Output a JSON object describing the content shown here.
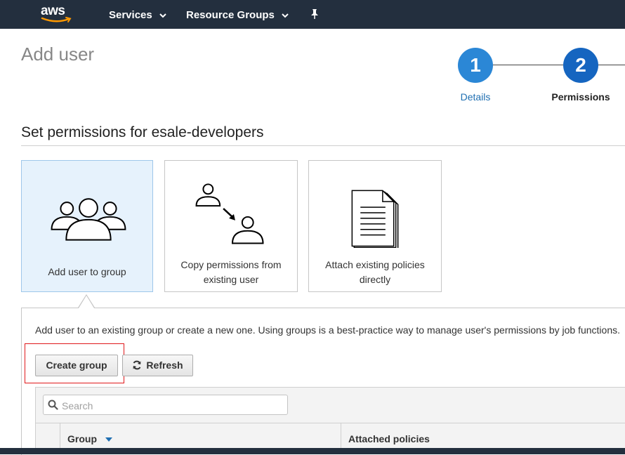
{
  "nav": {
    "logo_text": "aws",
    "services_label": "Services",
    "resource_groups_label": "Resource Groups",
    "bg_color": "#232f3e",
    "logo_smile_color": "#ff9900"
  },
  "page": {
    "title": "Add user"
  },
  "stepper": {
    "steps": [
      {
        "number": "1",
        "label": "Details",
        "state": "completed"
      },
      {
        "number": "2",
        "label": "Permissions",
        "state": "current"
      }
    ]
  },
  "section": {
    "title": "Set permissions for esale-developers"
  },
  "options": [
    {
      "label": "Add user to group",
      "icon": "users-group-icon",
      "selected": true
    },
    {
      "label": "Copy permissions from existing user",
      "icon": "copy-user-icon",
      "selected": false
    },
    {
      "label": "Attach existing policies directly",
      "icon": "documents-icon",
      "selected": false
    }
  ],
  "panel": {
    "description": "Add user to an existing group or create a new one. Using groups is a best-practice way to manage user's permissions by job functions.",
    "create_group_label": "Create group",
    "refresh_label": "Refresh",
    "search_placeholder": "Search",
    "table": {
      "columns": [
        "Group",
        "Attached policies"
      ],
      "sort_column": "Group",
      "sort_direction": "descending"
    }
  },
  "colors": {
    "accent": "#2b87d6",
    "highlight_box": "#e0181b",
    "selected_card_bg": "#e6f2fc"
  }
}
